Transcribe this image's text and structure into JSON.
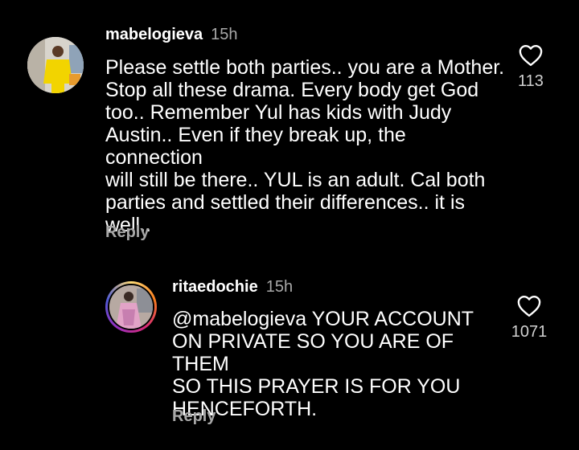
{
  "comments": [
    {
      "username": "mabelogieva",
      "time": "15h",
      "text": "Please settle both parties.. you are a Mother.\nStop all these drama. Every body get God\ntoo.. Remember Yul has kids with Judy\nAustin.. Even if they break up, the connection\nwill still be there.. YUL is an adult. Cal both\nparties and settled their differences.. it is\nwell..",
      "reply_label": "Reply",
      "like_count": "113",
      "like_icon": "heart-outline-icon"
    },
    {
      "username": "ritaedochie",
      "time": "15h",
      "text": "@mabelogieva YOUR ACCOUNT\nON PRIVATE SO YOU ARE OF THEM\nSO THIS PRAYER IS FOR YOU\nHENCEFORTH.",
      "reply_label": "Reply",
      "like_count": "1071",
      "like_icon": "heart-outline-icon",
      "has_story_ring": true
    }
  ],
  "colors": {
    "background": "#000000",
    "text": "#ffffff",
    "secondary_text": "#a8a8a8"
  }
}
